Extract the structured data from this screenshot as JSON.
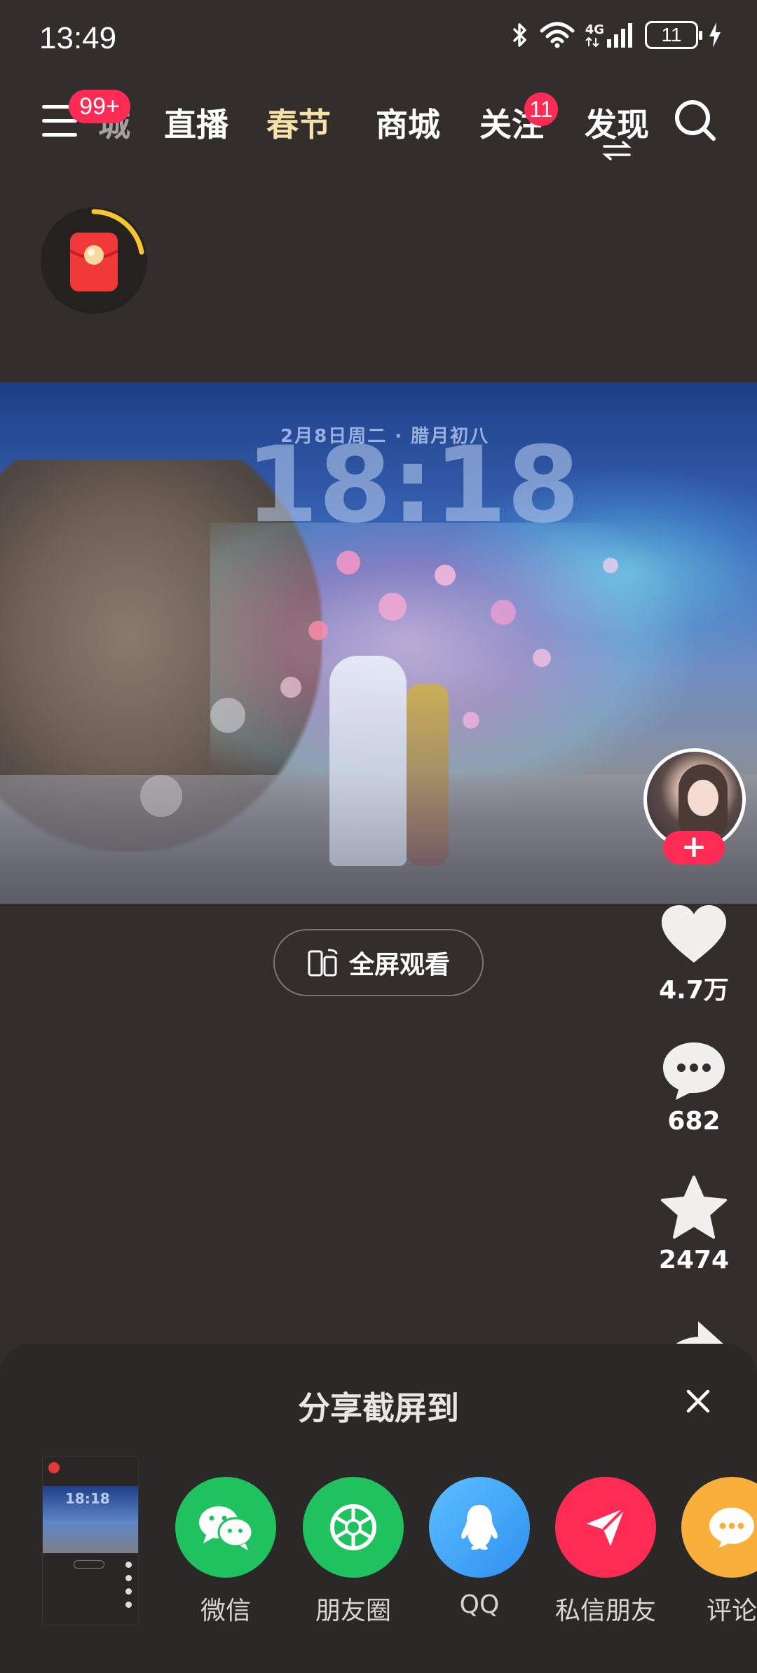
{
  "status_bar": {
    "time": "13:49",
    "network": "4G",
    "battery": "11"
  },
  "top_nav": {
    "menu_badge": "99+",
    "partial_tab": "城",
    "tabs": [
      "直播",
      "春节",
      "商城",
      "关注",
      "发现"
    ],
    "follow_badge": "11"
  },
  "video": {
    "overlay_date": "2月8日周二 · 腊月初八",
    "overlay_clock": "18:18"
  },
  "actions": {
    "likes": "4.7万",
    "comments": "682",
    "favorites": "2474"
  },
  "fullscreen_label": "全屏观看",
  "share_sheet": {
    "title": "分享截屏到",
    "thumbnail_clock": "18:18",
    "targets": [
      {
        "label": "微信",
        "color": "#1fc25f",
        "icon": "wechat-icon"
      },
      {
        "label": "朋友圈",
        "color": "#1fc25f",
        "icon": "moments-icon"
      },
      {
        "label": "QQ",
        "color": "#3aa8f5",
        "icon": "qq-icon"
      },
      {
        "label": "私信朋友",
        "color": "#fe2c55",
        "icon": "send-icon"
      },
      {
        "label": "评论",
        "color": "#f9b03a",
        "icon": "comment-icon"
      }
    ]
  },
  "colors": {
    "background": "#332d2b",
    "accent": "#fe2c55",
    "festival_tab": "#f6e2a8",
    "sheet": "#2b2828"
  }
}
